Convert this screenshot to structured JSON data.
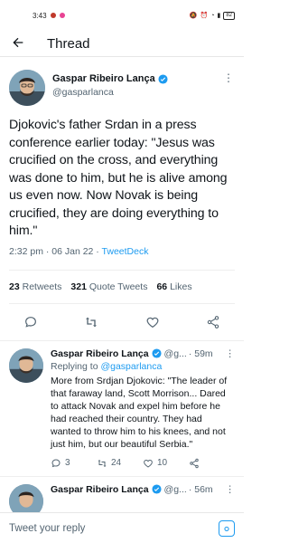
{
  "status_bar": {
    "time": "3:43",
    "battery": "82",
    "colors": {
      "notif1": "#c0392b",
      "notif2": "#e84393"
    }
  },
  "header": {
    "title": "Thread",
    "back_icon": "arrow-left-icon"
  },
  "main_tweet": {
    "name": "Gaspar Ribeiro Lança",
    "handle": "@gasparlanca",
    "text": "Djokovic's father Srdan in a press conference earlier today: \"Jesus was crucified on the cross, and everything was done to him, but he is alive among us even now. Now Novak is being crucified, they are doing everything to him.\"",
    "time": "2:32 pm · 06 Jan 22 · ",
    "source": "TweetDeck",
    "stats": {
      "retweets_count": "23",
      "retweets_label": "Retweets",
      "quotes_count": "321",
      "quotes_label": "Quote Tweets",
      "likes_count": "66",
      "likes_label": "Likes"
    }
  },
  "replies": [
    {
      "name": "Gaspar Ribeiro Lança",
      "handle": "@g...",
      "time": "· 59m",
      "replying_prefix": "Replying to ",
      "replying_to": "@gasparlanca",
      "text": "More from Srdjan Djokovic: \"The leader of that faraway land, Scott Morrison... Dared to attack Novak and expel him before he had reached their country. They had wanted to throw him to his knees, and not just him, but our beautiful Serbia.\"",
      "reply_count": "3",
      "retweet_count": "24",
      "like_count": "10"
    },
    {
      "name": "Gaspar Ribeiro Lança",
      "handle": "@g...",
      "time": "· 56m"
    }
  ],
  "compose": {
    "placeholder": "Tweet your reply"
  },
  "colors": {
    "accent": "#1d9bf0",
    "text": "#0f1419",
    "muted": "#536471"
  }
}
